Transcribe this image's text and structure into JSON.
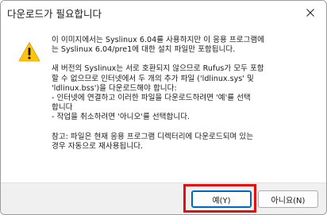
{
  "dialog": {
    "title": "다운로드가 필요합니다",
    "paragraphs": [
      "이 이미지에서는 Syslinux 6.04를 사용하지만 이 응용 프로그램에\n는 Syslinux 6.04/pre1에 대한 설치 파일만 포함됩니다.",
      "새 버전의 Syslinux는 서로 호환되지 않으므로 Rufus가 모두 포함\n할 수 없으므로 인터넷에서 두 개의 추가 파일 ('ldlinux.sys' 및\n'ldlinux.bss')을 다운로드해야 합니다:\n- 인터넷에 연결하고 이러한 파일을 다운로드하려면 '예'를 선택\n합니다\n- 작업을 취소하려면 '아니오'를 선택합니다.",
      "참고: 파일은 현재 응용 프로그램 디렉터리에 다운로드되며 있는\n경우 자동으로 재사용됩니다."
    ],
    "yes_label": "예(Y)",
    "no_label": "아니요(N)"
  },
  "icons": {
    "close": "close-icon",
    "warning": "warning-icon"
  },
  "colors": {
    "warning_fill": "#ffc40d",
    "focus_border": "#0067c0",
    "annotation_red": "#e01010"
  }
}
